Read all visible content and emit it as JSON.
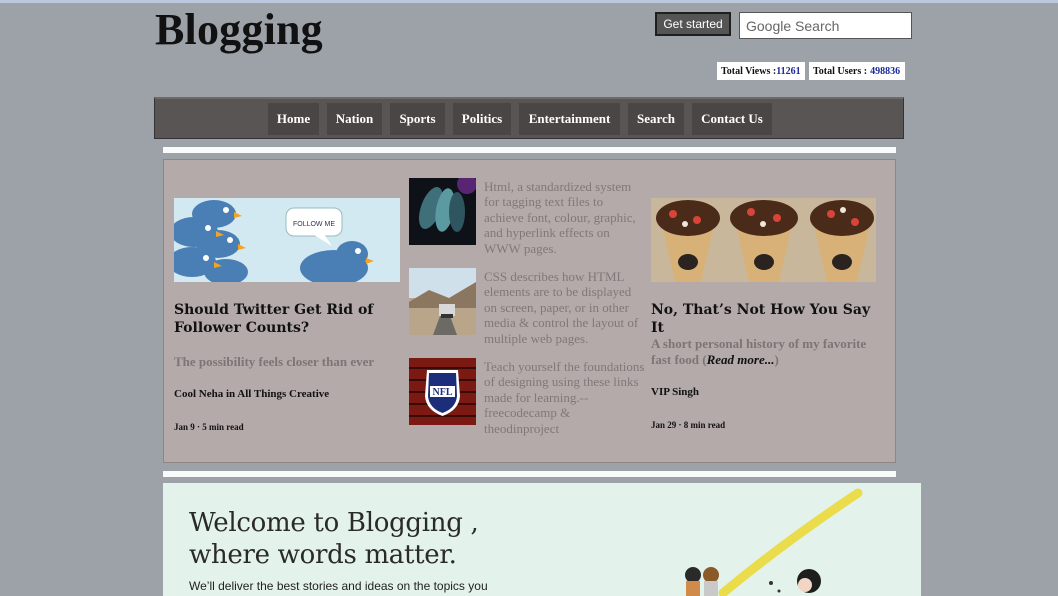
{
  "site": {
    "logo": "Blogging"
  },
  "header": {
    "get_started": "Get started",
    "search_placeholder": "Google Search",
    "views_label": "Total Views :",
    "views_value": "11261",
    "users_label": "Total Users : ",
    "users_value": "498836"
  },
  "nav": {
    "items": [
      "Home",
      "Nation",
      "Sports",
      "Politics",
      "Entertainment",
      "Search",
      "Contact Us"
    ]
  },
  "cards": {
    "left": {
      "image": "twitter-birds-follow-me",
      "image_caption": "FOLLOW ME",
      "title": "Should Twitter Get Rid of Follower Counts?",
      "subtitle": "The possibility feels closer than ever",
      "author": "Cool Neha in All Things Creative",
      "date": "Jan 9 · 5 min read"
    },
    "middle": [
      {
        "image": "abstract-blue-shapes",
        "text": "Html, a standardized system for tagging text files to achieve font, colour, graphic, and hyperlink effects on WWW pages."
      },
      {
        "image": "desert-highway-truck",
        "text": "CSS describes how HTML elements are to be displayed on screen, paper, or in other media & control the layout of multiple web pages."
      },
      {
        "image": "nfl-logo",
        "text": "Teach yourself the foundations of designing using these links made for learning.--freecodecamp & theodinproject"
      }
    ],
    "right": {
      "image": "waffle-cones-dessert",
      "title": "No, That’s Not How You Say It",
      "subtitle_text": "A short personal history of my favorite fast food (",
      "read_more": "Read more...",
      "subtitle_end": ")",
      "author": "VIP Singh",
      "date": "Jan 29 · 8 min read"
    }
  },
  "hero": {
    "title_line1": "Welcome to Blogging ,",
    "title_line2": "where words matter.",
    "subtitle": "We’ll deliver the best stories and ideas on the topics you"
  },
  "colors": {
    "page_bg": "#9ca2a8",
    "nav_bg": "#5a5555",
    "nav_item_bg": "#4b4646",
    "content_bg": "#b4aaaa",
    "hero_bg": "#e4f2ec",
    "stat_number": "#1b2a9a"
  }
}
